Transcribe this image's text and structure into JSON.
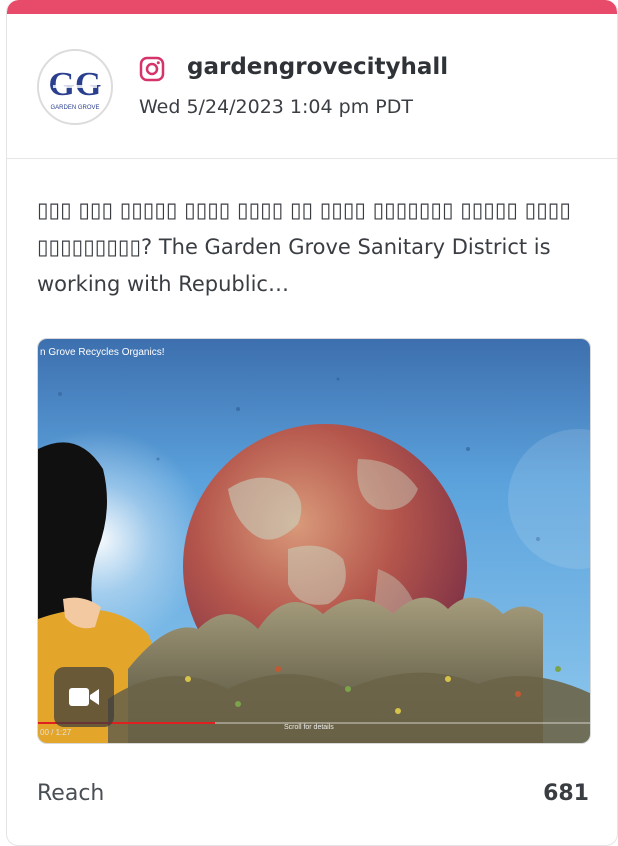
{
  "theme": {
    "accent": "#e84a6a",
    "instagram_icon_color": "#d6336c"
  },
  "post": {
    "network_icon": "instagram-icon",
    "account_name": "gardengrovecityhall",
    "date": "Wed 5/24/2023 1:04 pm PDT",
    "avatar": {
      "logo_letters": "GG",
      "logo_text": "GARDEN GROVE"
    },
    "caption": "▯▯▯ ▯▯▯ ▯▯▯▯▯ ▯▯▯▯ ▯▯▯▯ ▯▯ ▯▯▯▯ ▯▯▯▯▯▯▯ ▯▯▯▯▯ ▯▯▯▯ ▯▯▯▯▯▯▯▯▯? The Garden Grove Sanitary District is working with Republic…"
  },
  "media": {
    "type": "video",
    "video_title": "n Grove Recycles Organics!",
    "time_display": "00 / 1:27",
    "scroll_hint": "Scroll for details",
    "progress_fraction": 0.32,
    "badge_icon": "video-camera-icon"
  },
  "metrics": {
    "reach_label": "Reach",
    "reach_value": "681"
  }
}
